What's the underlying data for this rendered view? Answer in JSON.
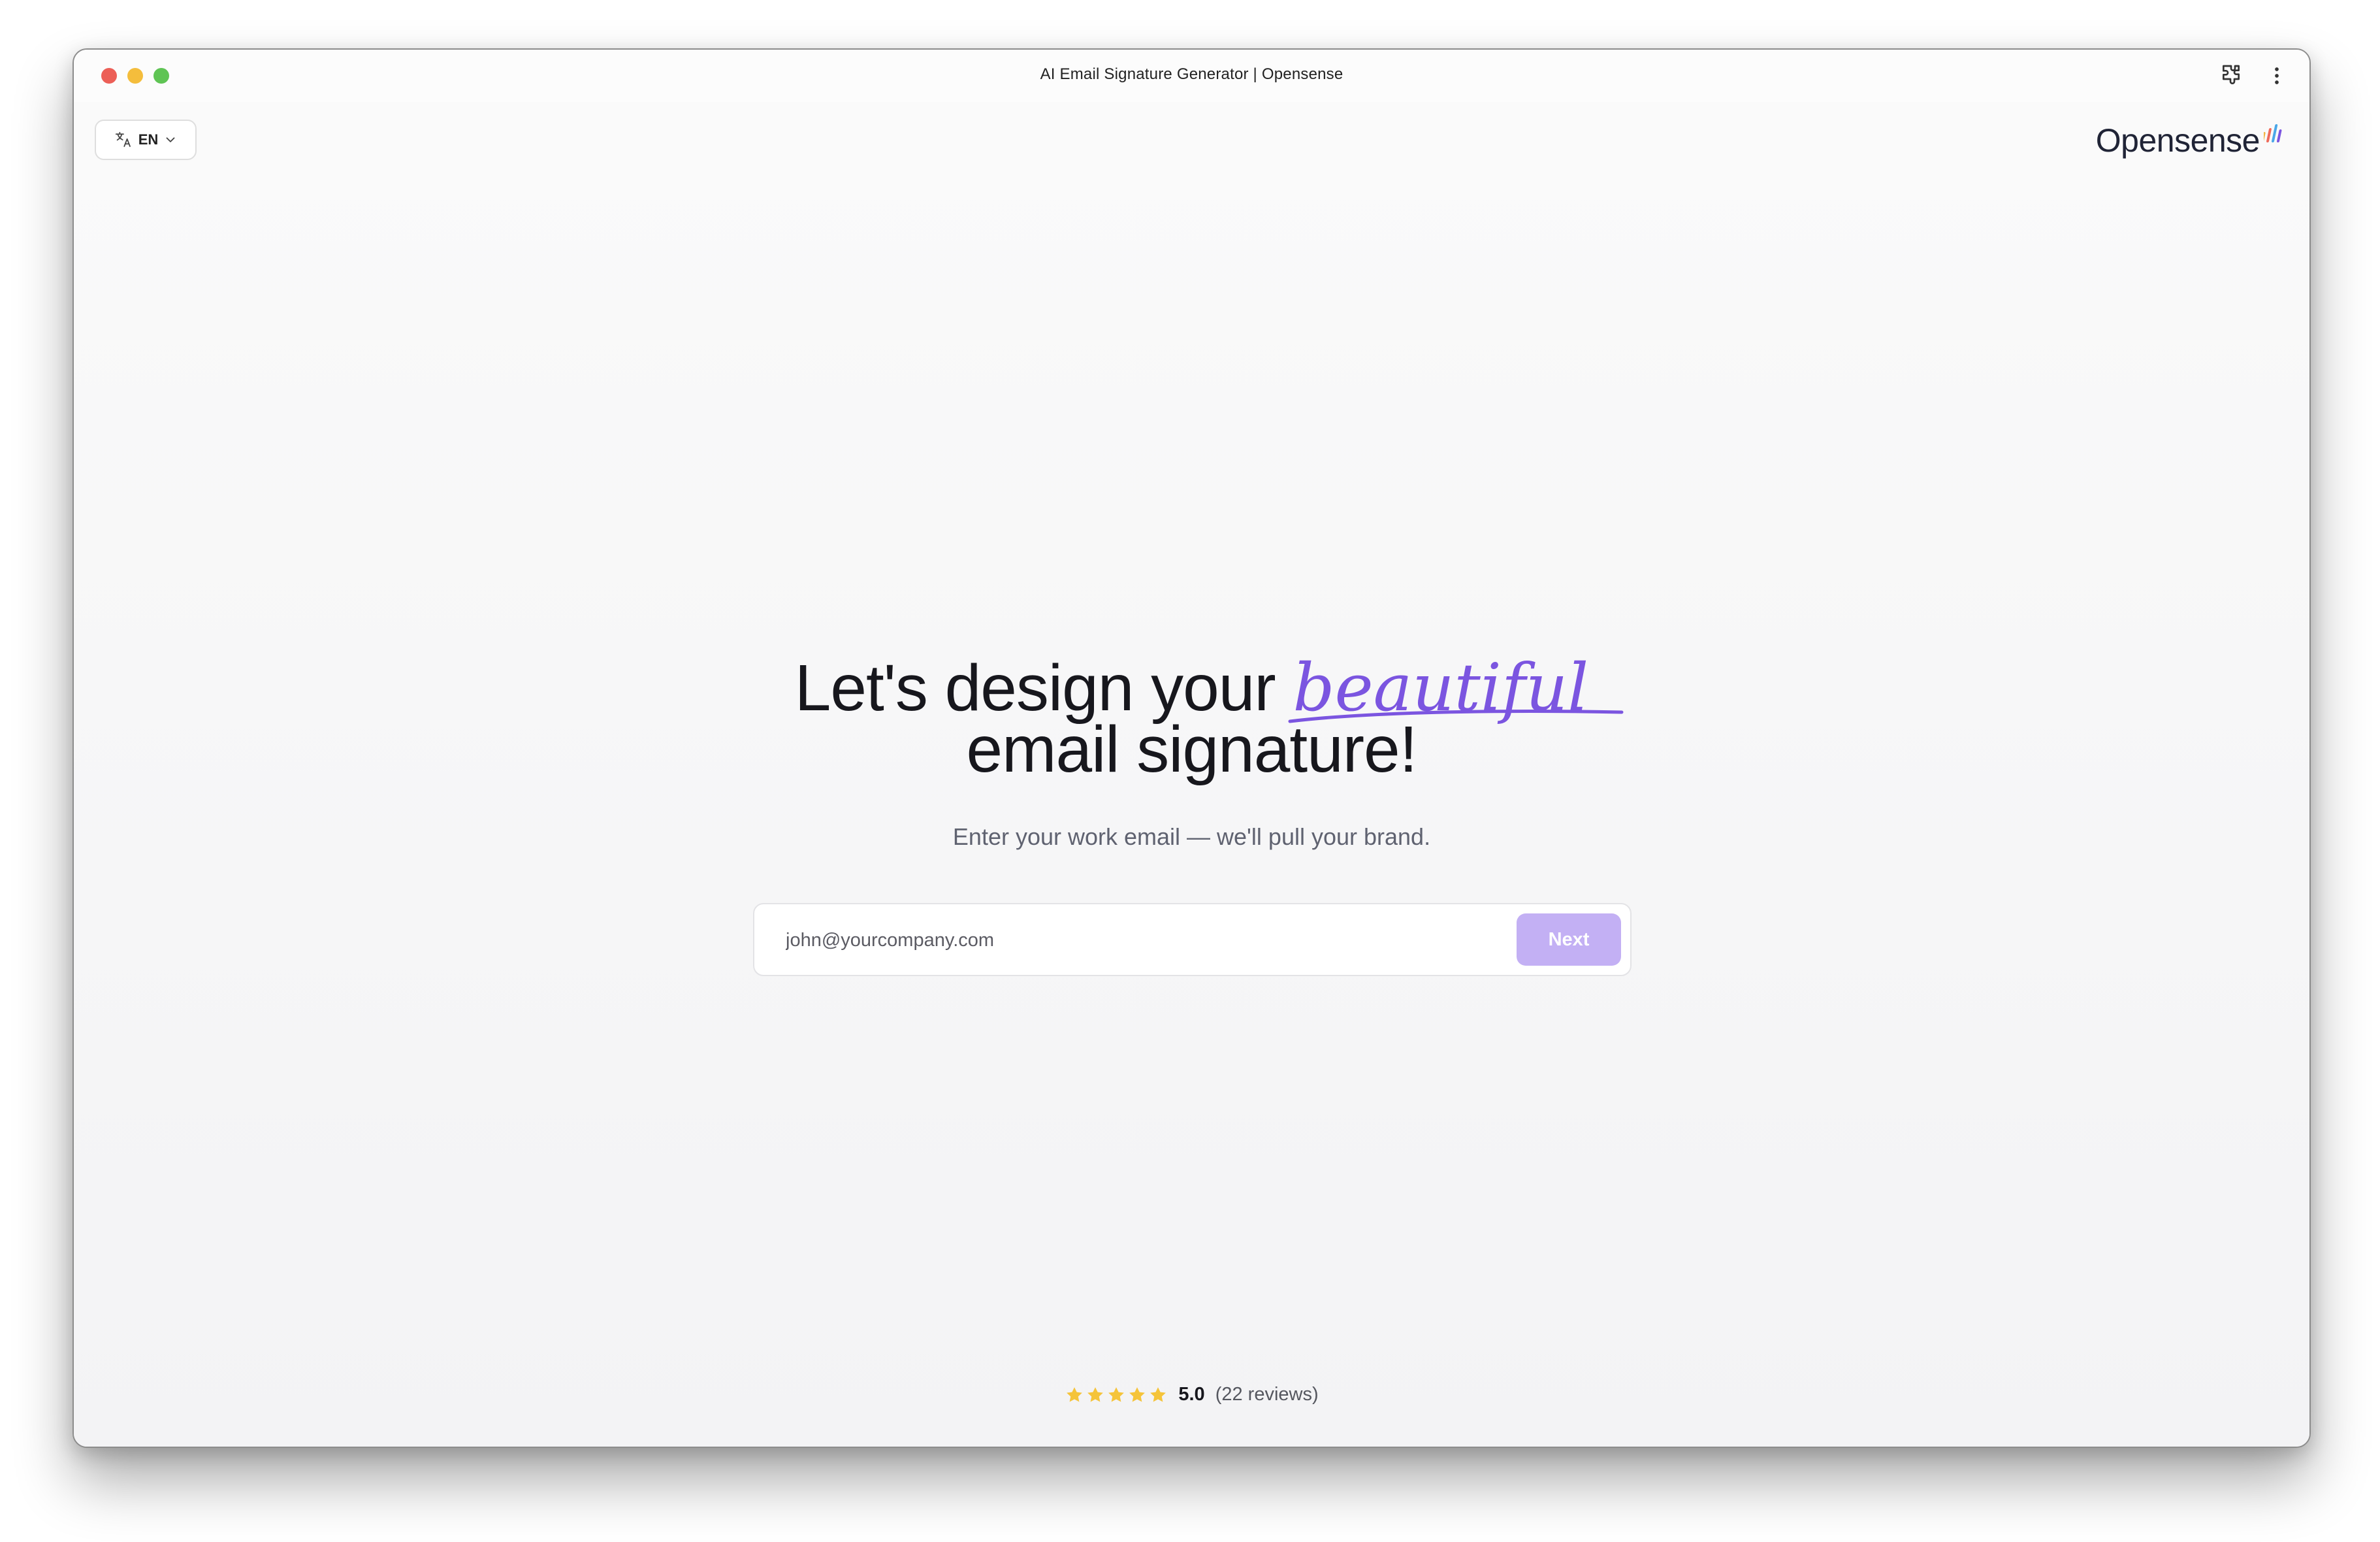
{
  "browser": {
    "title": "AI Email Signature Generator | Opensense"
  },
  "header": {
    "language_label": "EN",
    "logo_text": "Opensense"
  },
  "hero": {
    "headline_part1": "Let's design your",
    "headline_accent": "beautiful",
    "headline_part2": "email signature!",
    "subtitle": "Enter your work email — we'll pull your brand."
  },
  "form": {
    "email_placeholder": "john@yourcompany.com",
    "email_value": "",
    "next_label": "Next"
  },
  "rating": {
    "stars": 5,
    "score": "5.0",
    "reviews": "(22 reviews)"
  },
  "colors": {
    "accent": "#7b55e0",
    "next_button": "#c3b0f4",
    "star": "#f5c43a"
  }
}
